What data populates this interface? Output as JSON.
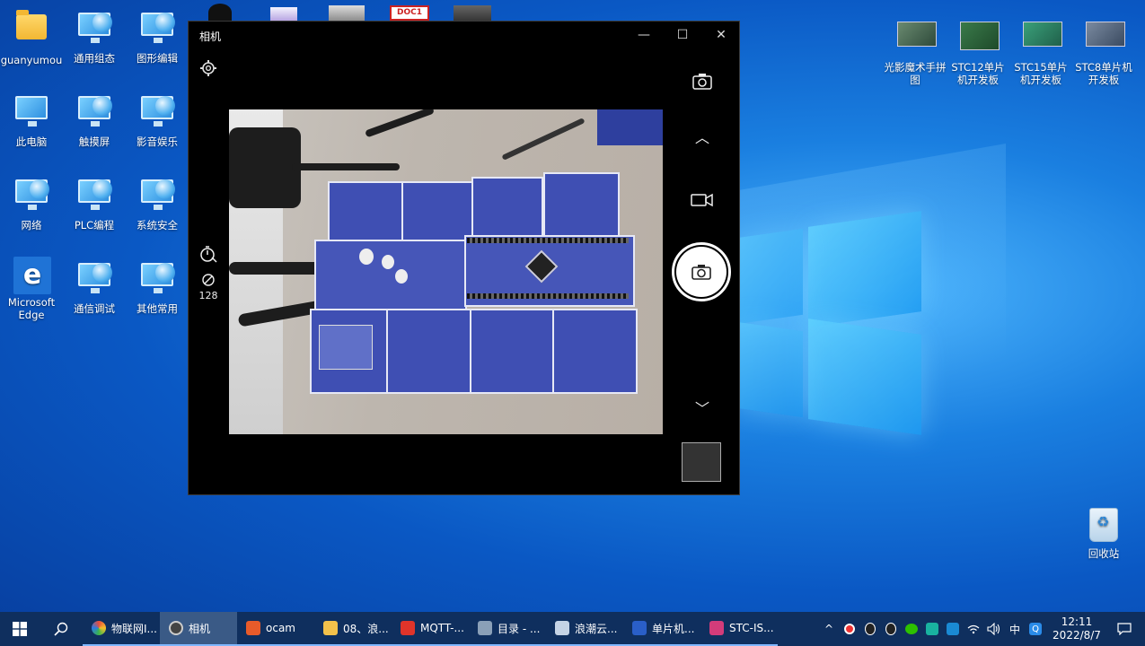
{
  "desktop": {
    "icons_left": [
      {
        "label": "guanyumou",
        "icon": "user-folder-icon"
      },
      {
        "label": "通用组态",
        "icon": "network-computer-icon"
      },
      {
        "label": "图形编辑",
        "icon": "network-computer-icon"
      },
      {
        "label": "此电脑",
        "icon": "this-pc-icon"
      },
      {
        "label": "触摸屏",
        "icon": "network-computer-icon"
      },
      {
        "label": "影音娱乐",
        "icon": "network-computer-icon"
      },
      {
        "label": "网络",
        "icon": "network-icon"
      },
      {
        "label": "PLC编程",
        "icon": "network-computer-icon"
      },
      {
        "label": "系统安全",
        "icon": "network-computer-icon"
      },
      {
        "label": "Microsoft Edge",
        "icon": "edge-icon"
      },
      {
        "label": "通信调试",
        "icon": "network-computer-icon"
      },
      {
        "label": "其他常用",
        "icon": "network-computer-icon"
      }
    ],
    "icons_right": [
      {
        "label": "光影魔术手拼图",
        "icon": "photo-thumbnail-icon"
      },
      {
        "label": "STC12单片机开发板",
        "icon": "photo-thumbnail-icon"
      },
      {
        "label": "STC15单片机开发板",
        "icon": "photo-thumbnail-icon"
      },
      {
        "label": "STC8单片机开发板",
        "icon": "photo-thumbnail-icon"
      }
    ],
    "recycle_bin": {
      "label": "回收站",
      "icon": "recycle-bin-icon"
    },
    "top_partial_icons": [
      "DOC1"
    ]
  },
  "camera_window": {
    "title": "相机",
    "minimize": "—",
    "maximize": "☐",
    "close": "✕",
    "settings_icon": "gear-icon",
    "switch_camera_icon": "switch-camera-icon",
    "timer_icon": "timer-icon",
    "brightness_icon": "brightness-icon",
    "brightness_value": "128",
    "up_chevron": "︿",
    "down_chevron": "﹀",
    "video_icon": "video-camera-icon",
    "shutter_icon": "camera-icon"
  },
  "taskbar": {
    "start_icon": "windows-start-icon",
    "search_icon": "search-icon",
    "apps": [
      {
        "label": "物联网I...",
        "color": "#e84c3d",
        "active": false
      },
      {
        "label": "相机",
        "color": "#555555",
        "active": true
      },
      {
        "label": "ocam",
        "color": "#e85b2a",
        "active": false
      },
      {
        "label": "08、浪...",
        "color": "#f2c14b",
        "active": false
      },
      {
        "label": "MQTT-...",
        "color": "#e0342a",
        "active": false
      },
      {
        "label": "目录 - ...",
        "color": "#8aa0b8",
        "active": false
      },
      {
        "label": "浪潮云...",
        "color": "#c5d4e6",
        "active": false
      },
      {
        "label": "单片机...",
        "color": "#2a5fc8",
        "active": false
      },
      {
        "label": "STC-IS...",
        "color": "#d33c7a",
        "active": false
      }
    ],
    "tray": {
      "chevron": "^",
      "ime": "中",
      "time": "12:11",
      "date": "2022/8/7"
    }
  }
}
